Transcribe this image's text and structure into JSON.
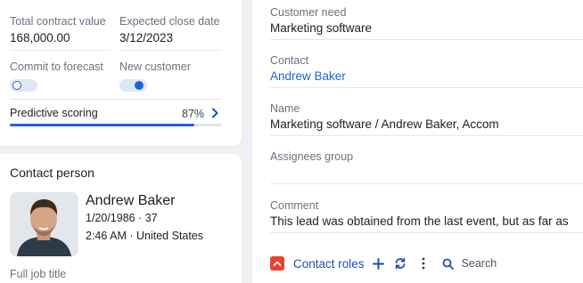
{
  "deal": {
    "total_contract_label": "Total contract value",
    "total_contract_value": "168,000.00",
    "expected_close_label": "Expected close date",
    "expected_close_value": "3/12/2023",
    "commit_label": "Commit to forecast",
    "commit_on": false,
    "new_customer_label": "New customer",
    "new_customer_on": true,
    "scoring_label": "Predictive scoring",
    "scoring_value": "87%",
    "scoring_fraction": 0.87
  },
  "contact_person": {
    "section_title": "Contact person",
    "name": "Andrew Baker",
    "birth_age": "1/20/1986 · 37",
    "time_location": "2:46 AM · United States",
    "job_title_label": "Full job title"
  },
  "lead": {
    "customer_need_label": "Customer need",
    "customer_need_value": "Marketing software",
    "contact_label": "Contact",
    "contact_value": "Andrew Baker",
    "name_label": "Name",
    "name_value": "Marketing software / Andrew Baker, Accom",
    "assignees_label": "Assignees group",
    "assignees_value": "",
    "comment_label": "Comment",
    "comment_value": "This lead was obtained from the last event, but as far as"
  },
  "contact_roles": {
    "title": "Contact roles",
    "search_label": "Search"
  },
  "colors": {
    "accent": "#1e63d6",
    "collapse": "#e8442d"
  }
}
